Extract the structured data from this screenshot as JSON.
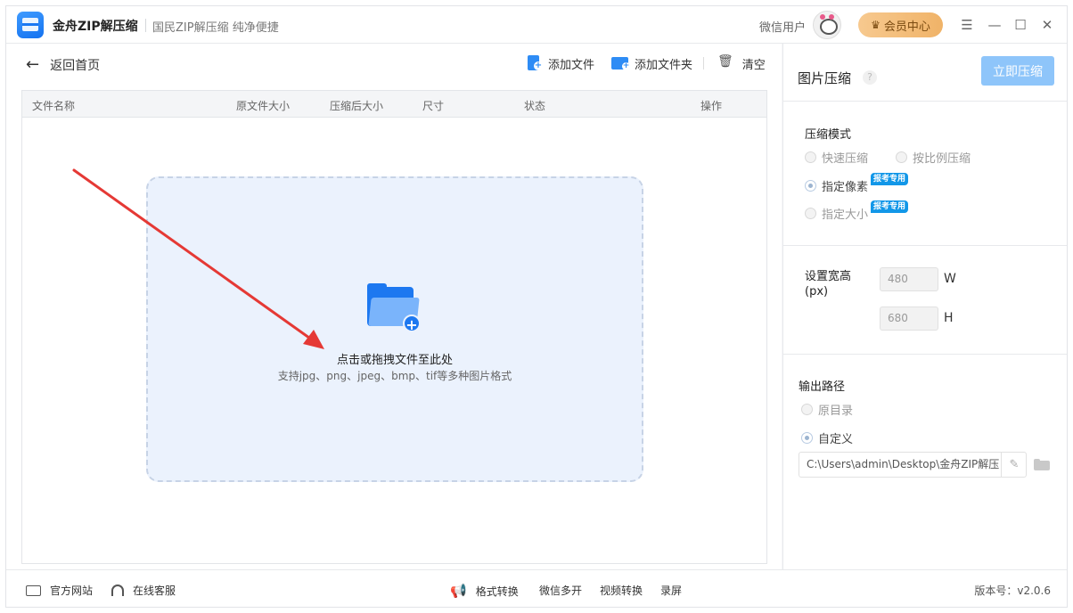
{
  "titlebar": {
    "app_name": "金舟ZIP解压缩",
    "slogan": "国民ZIP解压缩  纯净便捷",
    "user_name": "微信用户",
    "vip_label": "会员中心",
    "icons": [
      "menu-icon",
      "minimize-icon",
      "maximize-icon",
      "close-icon"
    ]
  },
  "toolbar": {
    "back_label": "返回首页",
    "add_file_label": "添加文件",
    "add_folder_label": "添加文件夹",
    "clear_label": "清空"
  },
  "table": {
    "columns": [
      "文件名称",
      "原文件大小",
      "压缩后大小",
      "尺寸",
      "状态",
      "操作"
    ],
    "rows": []
  },
  "dropzone": {
    "title": "点击或拖拽文件至此处",
    "hint": "支持jpg、png、jpeg、bmp、tif等多种图片格式"
  },
  "panel": {
    "title": "图片压缩",
    "help": "?",
    "compress_button": "立即压缩",
    "mode_title": "压缩模式",
    "modes": [
      {
        "label": "快速压缩",
        "checked": false,
        "badge": ""
      },
      {
        "label": "按比例压缩",
        "checked": false,
        "badge": ""
      },
      {
        "label": "指定像素",
        "checked": true,
        "badge": "报考专用"
      },
      {
        "label": "指定大小",
        "checked": false,
        "badge": "报考专用"
      }
    ],
    "size_title": "设置宽高",
    "size_unit": "(px)",
    "width_placeholder": "480",
    "height_placeholder": "680",
    "width_unit": "W",
    "height_unit": "H",
    "output_title": "输出路径",
    "output_options": [
      {
        "label": "原目录",
        "checked": false
      },
      {
        "label": "自定义",
        "checked": true
      }
    ],
    "output_path": "C:\\Users\\admin\\Desktop\\金舟ZIP解压"
  },
  "footer": {
    "website": "官方网站",
    "support": "在线客服",
    "format_convert": "格式转换",
    "wechat_multi": "微信多开",
    "video_convert": "视频转换",
    "record": "录屏",
    "version": "版本号：v2.0.6"
  },
  "colors": {
    "accent": "#1d78f0",
    "compress_button": "#8ec5fa",
    "badge": "#1297e8",
    "vip": "#f0b368",
    "dropzone_bg": "#ebf2fd",
    "annotation_arrow": "#e53935"
  }
}
